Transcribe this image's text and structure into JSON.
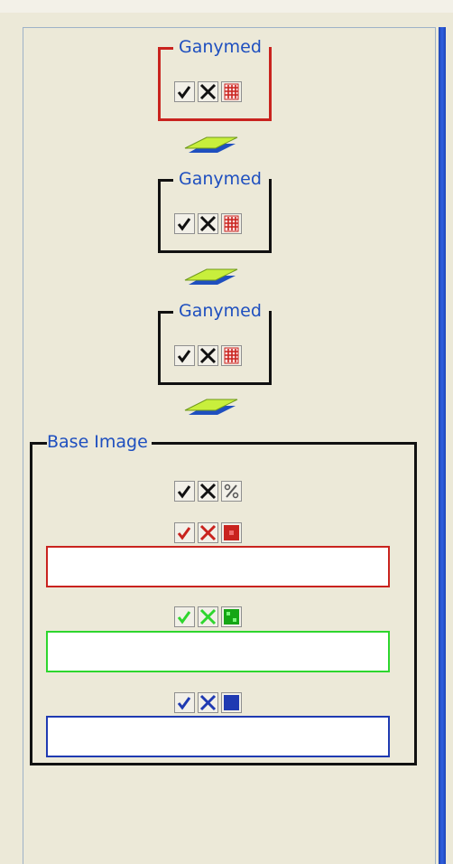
{
  "layers": [
    {
      "title": "Ganymed",
      "selected": true
    },
    {
      "title": "Ganymed",
      "selected": false
    },
    {
      "title": "Ganymed",
      "selected": false
    }
  ],
  "layer_icons": [
    "check-icon",
    "cross-icon",
    "palette-icon"
  ],
  "base": {
    "title": "Base Image",
    "icons": [
      "check-icon",
      "cross-icon",
      "percent-icon"
    ],
    "channels": [
      {
        "name": "red",
        "color": "#c9231e",
        "value": ""
      },
      {
        "name": "green",
        "color": "#2ed62e",
        "value": ""
      },
      {
        "name": "blue",
        "color": "#1f3ab2",
        "value": ""
      }
    ]
  },
  "colors": {
    "background": "#ece9d8",
    "title_text": "#1e4fbf",
    "selected_border": "#c9231e",
    "frame_border": "#9eb2c7",
    "right_bar": "#2f5fe0"
  }
}
